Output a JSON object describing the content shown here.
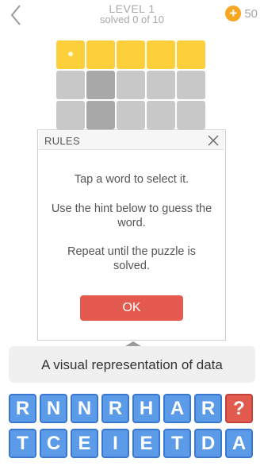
{
  "header": {
    "level_title": "LEVEL 1",
    "level_subtitle": "solved 0 of 10",
    "coin_symbol": "+",
    "coins": "50"
  },
  "rules_dialog": {
    "title": "RULES",
    "line1": "Tap a word to select it.",
    "line2": "Use the hint below to guess the word.",
    "line3": "Repeat until the puzzle is solved.",
    "ok_label": "OK"
  },
  "hint": {
    "text": "A visual representation of data"
  },
  "letters": {
    "row1": [
      "R",
      "N",
      "N",
      "R",
      "H",
      "A",
      "R"
    ],
    "row2": [
      "T",
      "C",
      "E",
      "I",
      "E",
      "T",
      "D",
      "A"
    ],
    "help_label": "?"
  },
  "colors": {
    "accent_yellow": "#fdd03b",
    "tile_blue": "#5b9be8",
    "button_red": "#e55a4e",
    "coin_orange": "#f5a623"
  }
}
